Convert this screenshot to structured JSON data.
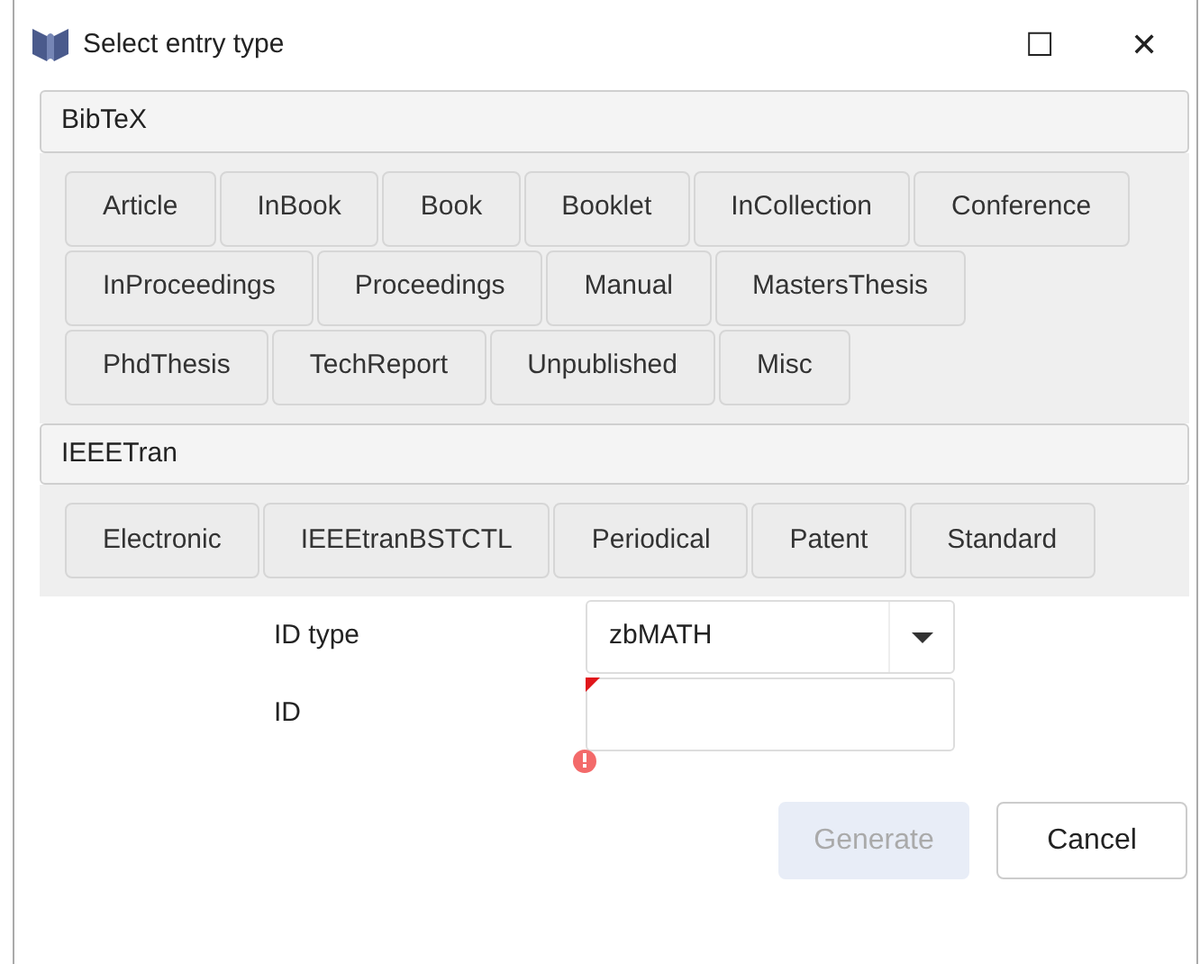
{
  "window": {
    "title": "Select entry type",
    "controls": [
      "☐",
      "✕"
    ]
  },
  "groups": [
    {
      "title": "BibTeX",
      "types": [
        "Article",
        "InBook",
        "Book",
        "Booklet",
        "InCollection",
        "Conference",
        "InProceedings",
        "Proceedings",
        "Manual",
        "MastersThesis",
        "PhdThesis",
        "TechReport",
        "Unpublished",
        "Misc"
      ]
    },
    {
      "title": "IEEETran",
      "types": [
        "Electronic",
        "IEEEtranBSTCTL",
        "Periodical",
        "Patent",
        "Standard"
      ]
    }
  ],
  "form": {
    "id_type": {
      "label": "ID type",
      "value": "zbMATH"
    },
    "id": {
      "label": "ID",
      "invalid": true
    }
  },
  "buttons": [
    {
      "label": "Generate",
      "disabled": true
    },
    {
      "label": "Cancel",
      "disabled": false
    }
  ]
}
